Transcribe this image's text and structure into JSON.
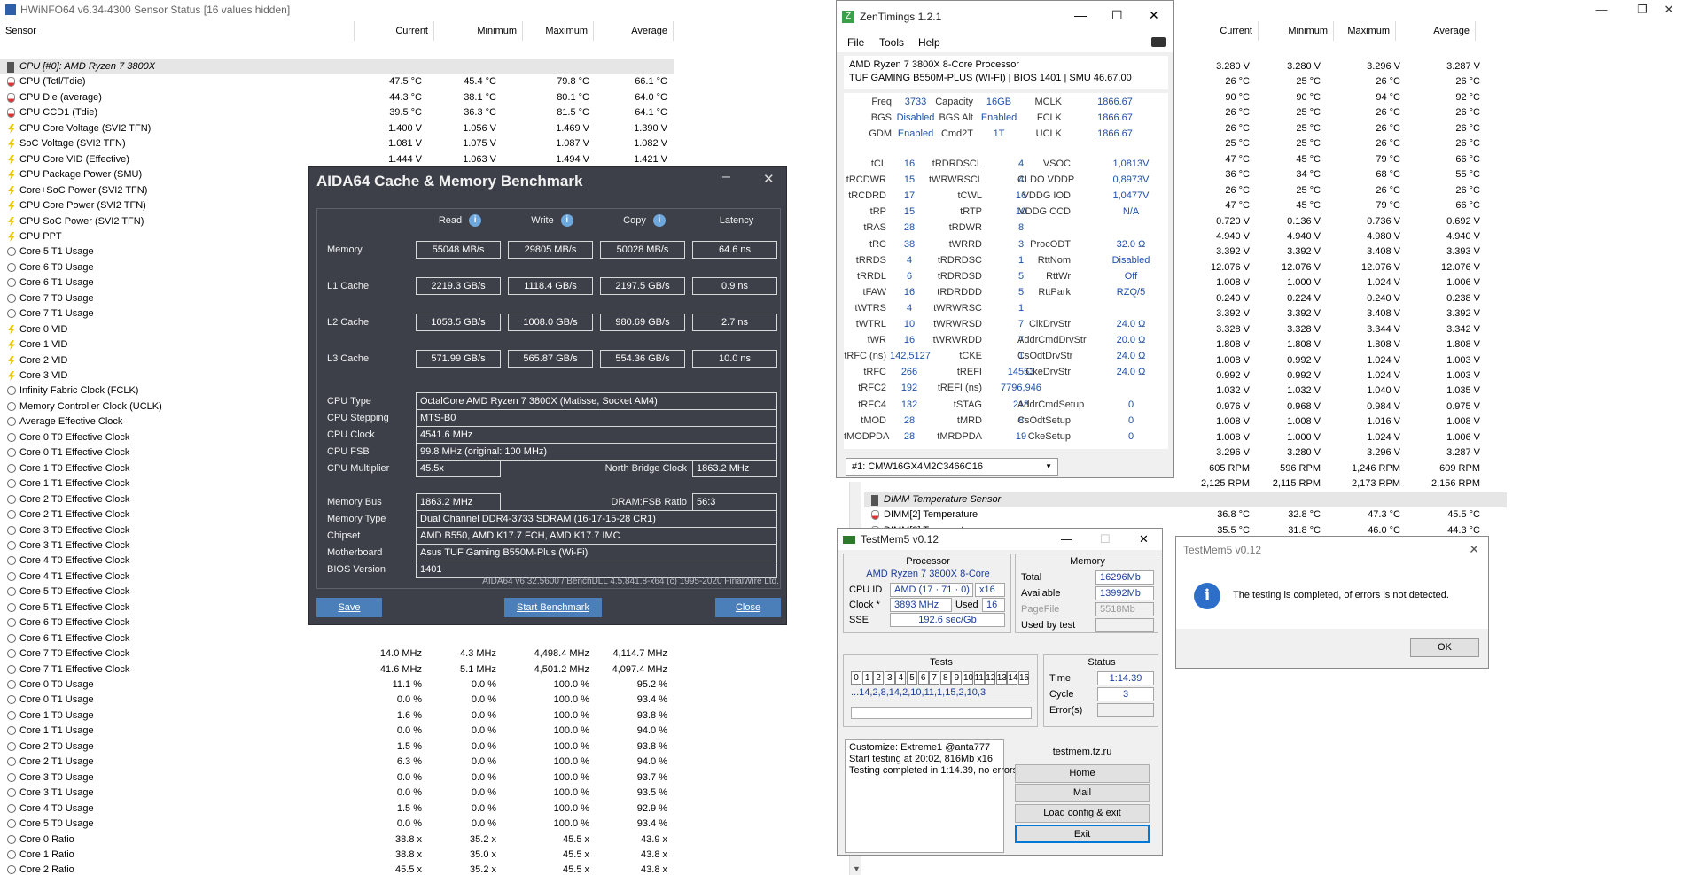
{
  "hwinfo": {
    "title": "HWiNFO64 v6.34-4300 Sensor Status [16 values hidden]",
    "cols": [
      "Sensor",
      "Current",
      "Minimum",
      "Maximum",
      "Average"
    ],
    "group": "CPU [#0]: AMD Ryzen 7 3800X",
    "rows": [
      [
        "temp",
        "CPU (Tctl/Tdie)",
        "47.5 °C",
        "45.4 °C",
        "79.8 °C",
        "66.1 °C"
      ],
      [
        "temp",
        "CPU Die (average)",
        "44.3 °C",
        "38.1 °C",
        "80.1 °C",
        "64.0 °C"
      ],
      [
        "temp",
        "CPU CCD1 (Tdie)",
        "39.5 °C",
        "36.3 °C",
        "81.5 °C",
        "64.1 °C"
      ],
      [
        "volt",
        "CPU Core Voltage (SVI2 TFN)",
        "1.400 V",
        "1.056 V",
        "1.469 V",
        "1.390 V"
      ],
      [
        "volt",
        "SoC Voltage (SVI2 TFN)",
        "1.081 V",
        "1.075 V",
        "1.087 V",
        "1.082 V"
      ],
      [
        "volt",
        "CPU Core VID (Effective)",
        "1.444 V",
        "1.063 V",
        "1.494 V",
        "1.421 V"
      ],
      [
        "volt",
        "CPU Package Power (SMU)",
        "",
        "",
        "",
        ""
      ],
      [
        "volt",
        "Core+SoC Power (SVI2 TFN)",
        "",
        "",
        "",
        ""
      ],
      [
        "volt",
        "CPU Core Power (SVI2 TFN)",
        "",
        "",
        "",
        ""
      ],
      [
        "volt",
        "CPU SoC Power (SVI2 TFN)",
        "",
        "",
        "",
        ""
      ],
      [
        "volt",
        "CPU PPT",
        "",
        "",
        "",
        ""
      ],
      [
        "clock",
        "Core 5 T1 Usage",
        "",
        "",
        "",
        ""
      ],
      [
        "clock",
        "Core 6 T0 Usage",
        "",
        "",
        "",
        ""
      ],
      [
        "clock",
        "Core 6 T1 Usage",
        "",
        "",
        "",
        ""
      ],
      [
        "clock",
        "Core 7 T0 Usage",
        "",
        "",
        "",
        ""
      ],
      [
        "clock",
        "Core 7 T1 Usage",
        "",
        "",
        "",
        ""
      ],
      [
        "volt",
        "Core 0 VID",
        "",
        "",
        "",
        ""
      ],
      [
        "volt",
        "Core 1 VID",
        "",
        "",
        "",
        ""
      ],
      [
        "volt",
        "Core 2 VID",
        "",
        "",
        "",
        ""
      ],
      [
        "volt",
        "Core 3 VID",
        "",
        "",
        "",
        ""
      ],
      [
        "clock",
        "Infinity Fabric Clock (FCLK)",
        "",
        "",
        "",
        ""
      ],
      [
        "clock",
        "Memory Controller Clock (UCLK)",
        "",
        "",
        "",
        ""
      ],
      [
        "clock",
        "Average Effective Clock",
        "",
        "",
        "",
        ""
      ],
      [
        "clock",
        "Core 0 T0 Effective Clock",
        "",
        "",
        "",
        ""
      ],
      [
        "clock",
        "Core 0 T1 Effective Clock",
        "",
        "",
        "",
        ""
      ],
      [
        "clock",
        "Core 1 T0 Effective Clock",
        "",
        "",
        "",
        ""
      ],
      [
        "clock",
        "Core 1 T1 Effective Clock",
        "",
        "",
        "",
        ""
      ],
      [
        "clock",
        "Core 2 T0 Effective Clock",
        "",
        "",
        "",
        ""
      ],
      [
        "clock",
        "Core 2 T1 Effective Clock",
        "",
        "",
        "",
        ""
      ],
      [
        "clock",
        "Core 3 T0 Effective Clock",
        "",
        "",
        "",
        ""
      ],
      [
        "clock",
        "Core 3 T1 Effective Clock",
        "",
        "",
        "",
        ""
      ],
      [
        "clock",
        "Core 4 T0 Effective Clock",
        "",
        "",
        "",
        ""
      ],
      [
        "clock",
        "Core 4 T1 Effective Clock",
        "",
        "",
        "",
        ""
      ],
      [
        "clock",
        "Core 5 T0 Effective Clock",
        "",
        "",
        "",
        ""
      ],
      [
        "clock",
        "Core 5 T1 Effective Clock",
        "",
        "",
        "",
        ""
      ],
      [
        "clock",
        "Core 6 T0 Effective Clock",
        "",
        "",
        "",
        ""
      ],
      [
        "clock",
        "Core 6 T1 Effective Clock",
        "",
        "",
        "",
        ""
      ],
      [
        "clock",
        "Core 7 T0 Effective Clock",
        "14.0 MHz",
        "4.3 MHz",
        "4,498.4 MHz",
        "4,114.7 MHz"
      ],
      [
        "clock",
        "Core 7 T1 Effective Clock",
        "41.6 MHz",
        "5.1 MHz",
        "4,501.2 MHz",
        "4,097.4 MHz"
      ],
      [
        "clock",
        "Core 0 T0 Usage",
        "11.1 %",
        "0.0 %",
        "100.0 %",
        "95.2 %"
      ],
      [
        "clock",
        "Core 0 T1 Usage",
        "0.0 %",
        "0.0 %",
        "100.0 %",
        "93.4 %"
      ],
      [
        "clock",
        "Core 1 T0 Usage",
        "1.6 %",
        "0.0 %",
        "100.0 %",
        "93.8 %"
      ],
      [
        "clock",
        "Core 1 T1 Usage",
        "0.0 %",
        "0.0 %",
        "100.0 %",
        "94.0 %"
      ],
      [
        "clock",
        "Core 2 T0 Usage",
        "1.5 %",
        "0.0 %",
        "100.0 %",
        "93.8 %"
      ],
      [
        "clock",
        "Core 2 T1 Usage",
        "6.3 %",
        "0.0 %",
        "100.0 %",
        "94.0 %"
      ],
      [
        "clock",
        "Core 3 T0 Usage",
        "0.0 %",
        "0.0 %",
        "100.0 %",
        "93.7 %"
      ],
      [
        "clock",
        "Core 3 T1 Usage",
        "0.0 %",
        "0.0 %",
        "100.0 %",
        "93.5 %"
      ],
      [
        "clock",
        "Core 4 T0 Usage",
        "1.5 %",
        "0.0 %",
        "100.0 %",
        "92.9 %"
      ],
      [
        "clock",
        "Core 5 T0 Usage",
        "0.0 %",
        "0.0 %",
        "100.0 %",
        "93.4 %"
      ],
      [
        "clock",
        "Core 0 Ratio",
        "38.8 x",
        "35.2 x",
        "45.5 x",
        "43.9 x"
      ],
      [
        "clock",
        "Core 1 Ratio",
        "38.8 x",
        "35.0 x",
        "45.5 x",
        "43.8 x"
      ],
      [
        "clock",
        "Core 2 Ratio",
        "45.5 x",
        "35.2 x",
        "45.5 x",
        "43.8 x"
      ],
      [
        "clock",
        "Core 3 Ratio",
        "38.8 x",
        "34.6 x",
        "45.5 x",
        "43.7 x"
      ]
    ],
    "right_rows": [
      [
        "3.280 V",
        "3.280 V",
        "3.296 V",
        "3.287 V"
      ],
      [
        "26 °C",
        "25 °C",
        "26 °C",
        "26 °C"
      ],
      [
        "90 °C",
        "90 °C",
        "94 °C",
        "92 °C"
      ],
      [
        "26 °C",
        "25 °C",
        "26 °C",
        "26 °C"
      ],
      [
        "26 °C",
        "25 °C",
        "26 °C",
        "26 °C"
      ],
      [
        "25 °C",
        "25 °C",
        "26 °C",
        "26 °C"
      ],
      [
        "47 °C",
        "45 °C",
        "79 °C",
        "66 °C"
      ],
      [
        "36 °C",
        "34 °C",
        "68 °C",
        "55 °C"
      ],
      [
        "26 °C",
        "25 °C",
        "26 °C",
        "26 °C"
      ],
      [
        "47 °C",
        "45 °C",
        "79 °C",
        "66 °C"
      ],
      [
        "0.720 V",
        "0.136 V",
        "0.736 V",
        "0.692 V"
      ],
      [
        "4.940 V",
        "4.940 V",
        "4.980 V",
        "4.940 V"
      ],
      [
        "3.392 V",
        "3.392 V",
        "3.408 V",
        "3.393 V"
      ],
      [
        "12.076 V",
        "12.076 V",
        "12.076 V",
        "12.076 V"
      ],
      [
        "1.008 V",
        "1.000 V",
        "1.024 V",
        "1.006 V"
      ],
      [
        "0.240 V",
        "0.224 V",
        "0.240 V",
        "0.238 V"
      ],
      [
        "3.392 V",
        "3.392 V",
        "3.408 V",
        "3.392 V"
      ],
      [
        "3.328 V",
        "3.328 V",
        "3.344 V",
        "3.342 V"
      ],
      [
        "1.808 V",
        "1.808 V",
        "1.808 V",
        "1.808 V"
      ],
      [
        "1.008 V",
        "0.992 V",
        "1.024 V",
        "1.003 V"
      ],
      [
        "0.992 V",
        "0.992 V",
        "1.024 V",
        "1.003 V"
      ],
      [
        "1.032 V",
        "1.032 V",
        "1.040 V",
        "1.035 V"
      ],
      [
        "0.976 V",
        "0.968 V",
        "0.984 V",
        "0.975 V"
      ],
      [
        "1.008 V",
        "1.008 V",
        "1.016 V",
        "1.008 V"
      ],
      [
        "1.008 V",
        "1.000 V",
        "1.024 V",
        "1.006 V"
      ],
      [
        "3.296 V",
        "3.280 V",
        "3.296 V",
        "3.287 V"
      ],
      [
        "605 RPM",
        "596 RPM",
        "1,246 RPM",
        "609 RPM"
      ],
      [
        "2,125 RPM",
        "2,115 RPM",
        "2,173 RPM",
        "2,156 RPM"
      ]
    ],
    "dimm_group": "DIMM Temperature Sensor",
    "dimm_rows": [
      [
        "DIMM[2] Temperature",
        "36.8 °C",
        "32.8 °C",
        "47.3 °C",
        "45.5 °C"
      ],
      [
        "DIMM[3] Temperature",
        "35.5 °C",
        "31.8 °C",
        "46.0 °C",
        "44.3 °C"
      ]
    ]
  },
  "aida": {
    "title": "AIDA64 Cache & Memory Benchmark",
    "headers": [
      "Read",
      "Write",
      "Copy",
      "Latency"
    ],
    "rows": [
      [
        "Memory",
        "55048 MB/s",
        "29805 MB/s",
        "50028 MB/s",
        "64.6 ns"
      ],
      [
        "L1 Cache",
        "2219.3 GB/s",
        "1118.4 GB/s",
        "2197.5 GB/s",
        "0.9 ns"
      ],
      [
        "L2 Cache",
        "1053.5 GB/s",
        "1008.0 GB/s",
        "980.69 GB/s",
        "2.7 ns"
      ],
      [
        "L3 Cache",
        "571.99 GB/s",
        "565.87 GB/s",
        "554.36 GB/s",
        "10.0 ns"
      ]
    ],
    "cpu_type_label": "CPU Type",
    "cpu_type": "OctalCore AMD Ryzen 7 3800X  (Matisse, Socket AM4)",
    "cpu_stepping_label": "CPU Stepping",
    "cpu_stepping": "MTS-B0",
    "cpu_clock_label": "CPU Clock",
    "cpu_clock": "4541.6 MHz",
    "cpu_fsb_label": "CPU FSB",
    "cpu_fsb": "99.8 MHz  (original: 100 MHz)",
    "cpu_mult_label": "CPU Multiplier",
    "cpu_mult": "45.5x",
    "nb_clock_label": "North Bridge Clock",
    "nb_clock": "1863.2 MHz",
    "mem_bus_label": "Memory Bus",
    "mem_bus": "1863.2 MHz",
    "dram_ratio_label": "DRAM:FSB Ratio",
    "dram_ratio": "56:3",
    "mem_type_label": "Memory Type",
    "mem_type": "Dual Channel DDR4-3733 SDRAM  (16-17-15-28 CR1)",
    "chipset_label": "Chipset",
    "chipset": "AMD B550, AMD K17.7 FCH, AMD K17.7 IMC",
    "mobo_label": "Motherboard",
    "mobo": "Asus TUF Gaming B550M-Plus (Wi-Fi)",
    "bios_label": "BIOS Version",
    "bios": "1401",
    "footer": "AIDA64 v6.32.5600 / BenchDLL 4.5.841.8-x64  (c) 1995-2020 FinalWire Ltd.",
    "save": "Save",
    "start": "Start Benchmark",
    "close": "Close"
  },
  "zen": {
    "title": "ZenTimings 1.2.1",
    "menu": [
      "File",
      "Tools",
      "Help"
    ],
    "cpu": "AMD Ryzen 7 3800X 8-Core Processor",
    "board": "TUF GAMING B550M-PLUS (WI-FI) | BIOS 1401 | SMU 46.67.00",
    "top": [
      [
        "Freq",
        "3733",
        "Capacity",
        "16GB",
        "MCLK",
        "1866.67"
      ],
      [
        "BGS",
        "Disabled",
        "BGS Alt",
        "Enabled",
        "FCLK",
        "1866.67"
      ],
      [
        "GDM",
        "Enabled",
        "Cmd2T",
        "1T",
        "UCLK",
        "1866.67"
      ]
    ],
    "timings": [
      [
        "tCL",
        "16",
        "tRDRDSCL",
        "4",
        "VSOC",
        "1,0813V"
      ],
      [
        "tRCDWR",
        "15",
        "tWRWRSCL",
        "4",
        "CLDO VDDP",
        "0,8973V"
      ],
      [
        "tRCDRD",
        "17",
        "tCWL",
        "16",
        "VDDG IOD",
        "1,0477V"
      ],
      [
        "tRP",
        "15",
        "tRTP",
        "10",
        "VDDG CCD",
        "N/A"
      ],
      [
        "tRAS",
        "28",
        "tRDWR",
        "8",
        "",
        ""
      ],
      [
        "tRC",
        "38",
        "tWRRD",
        "3",
        "ProcODT",
        "32.0 Ω"
      ],
      [
        "tRRDS",
        "4",
        "tRDRDSC",
        "1",
        "RttNom",
        "Disabled"
      ],
      [
        "tRRDL",
        "6",
        "tRDRDSD",
        "5",
        "RttWr",
        "Off"
      ],
      [
        "tFAW",
        "16",
        "tRDRDDD",
        "5",
        "RttPark",
        "RZQ/5"
      ],
      [
        "tWTRS",
        "4",
        "tWRWRSC",
        "1",
        "",
        ""
      ],
      [
        "tWTRL",
        "10",
        "tWRWRSD",
        "7",
        "ClkDrvStr",
        "24.0 Ω"
      ],
      [
        "tWR",
        "16",
        "tWRWRDD",
        "7",
        "AddrCmdDrvStr",
        "20.0 Ω"
      ],
      [
        "tRFC (ns)",
        "142,5127",
        "tCKE",
        "1",
        "CsOdtDrvStr",
        "24.0 Ω"
      ],
      [
        "tRFC",
        "266",
        "tREFI",
        "14553",
        "CkeDrvStr",
        "24.0 Ω"
      ],
      [
        "tRFC2",
        "192",
        "tREFI (ns)",
        "7796,946",
        "",
        ""
      ],
      [
        "tRFC4",
        "132",
        "tSTAG",
        "218",
        "AddrCmdSetup",
        "0"
      ],
      [
        "tMOD",
        "28",
        "tMRD",
        "8",
        "CsOdtSetup",
        "0"
      ],
      [
        "tMODPDA",
        "28",
        "tMRDPDA",
        "19",
        "CkeSetup",
        "0"
      ]
    ],
    "module": "#1: CMW16GX4M2C3466C16"
  },
  "testmem": {
    "title": "TestMem5 v0.12",
    "processor_label": "Processor",
    "processor": "AMD Ryzen 7 3800X 8-Core",
    "cpuid_label": "CPU ID",
    "cpuid": "AMD  (17 · 71 · 0)",
    "threads": "x16",
    "clock_label": "Clock *",
    "clock": "3893 MHz",
    "used_label": "Used",
    "used": "16",
    "sse_label": "SSE",
    "sse": "192.6 sec/Gb",
    "memory_label": "Memory",
    "total_label": "Total",
    "total": "16296Mb",
    "available_label": "Available",
    "available": "13992Mb",
    "pagefile_label": "PageFile",
    "pagefile": "5518Mb",
    "usedbytest_label": "Used by test",
    "tests_label": "Tests",
    "tests": [
      "0",
      "1",
      "2",
      "3",
      "4",
      "5",
      "6",
      "7",
      "8",
      "9",
      "10",
      "11",
      "12",
      "13",
      "14",
      "15"
    ],
    "sequence": "...14,2,8,14,2,10,11,1,15,2,10,3",
    "status_label": "Status",
    "time_label": "Time",
    "time": "1:14.39",
    "cycle_label": "Cycle",
    "cycle": "3",
    "errors_label": "Error(s)",
    "log": [
      "Customize: Extreme1 @anta777",
      "Start testing at 20:02, 816Mb x16",
      "Testing completed in 1:14.39, no errors."
    ],
    "site": "testmem.tz.ru",
    "home": "Home",
    "mail": "Mail",
    "load": "Load config & exit",
    "exit": "Exit"
  },
  "dialog": {
    "title": "TestMem5 v0.12",
    "message": "The testing is completed, of errors is not detected.",
    "ok": "OK"
  }
}
